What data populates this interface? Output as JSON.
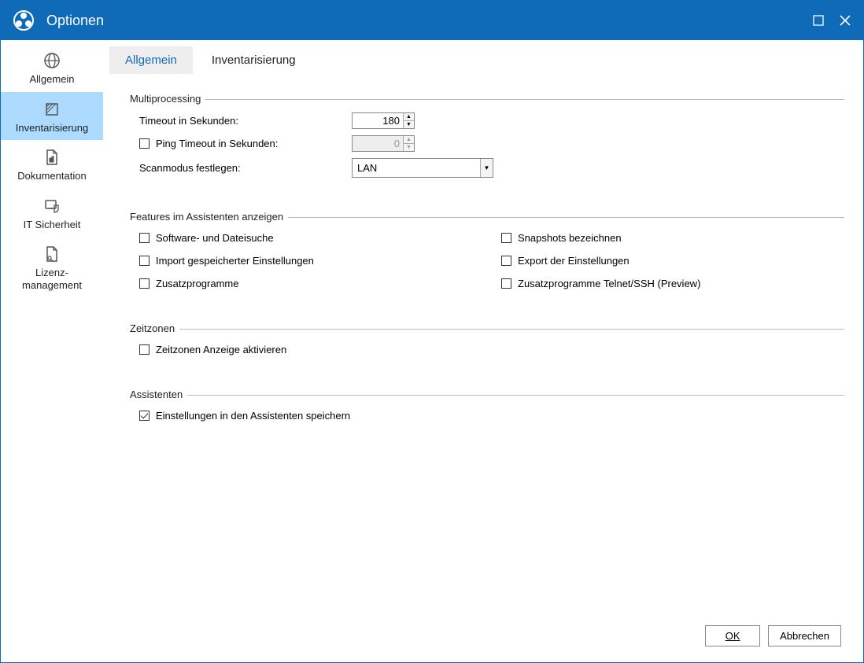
{
  "window": {
    "title": "Optionen"
  },
  "sidebar": {
    "items": [
      {
        "label": "Allgemein"
      },
      {
        "label": "Inventarisierung"
      },
      {
        "label": "Dokumentation"
      },
      {
        "label": "IT Sicherheit"
      },
      {
        "label": "Lizenz-\nmanagement"
      }
    ]
  },
  "tabs": {
    "allgemein": "Allgemein",
    "inventarisierung": "Inventarisierung"
  },
  "sections": {
    "multiprocessing": {
      "title": "Multiprocessing",
      "timeout_label": "Timeout in Sekunden:",
      "timeout_value": "180",
      "ping_timeout_label": "Ping Timeout in Sekunden:",
      "ping_timeout_value": "0",
      "scanmode_label": "Scanmodus festlegen:",
      "scanmode_value": "LAN"
    },
    "features": {
      "title": "Features im Assistenten anzeigen",
      "items": [
        "Software- und Dateisuche",
        "Snapshots bezeichnen",
        "Import gespeicherter Einstellungen",
        "Export der Einstellungen",
        "Zusatzprogramme",
        "Zusatzprogramme Telnet/SSH (Preview)"
      ]
    },
    "zeitzonen": {
      "title": "Zeitzonen",
      "label": "Zeitzonen Anzeige aktivieren"
    },
    "assistenten": {
      "title": "Assistenten",
      "label": "Einstellungen in den Assistenten speichern"
    }
  },
  "footer": {
    "ok": "OK",
    "cancel": "Abbrechen"
  }
}
